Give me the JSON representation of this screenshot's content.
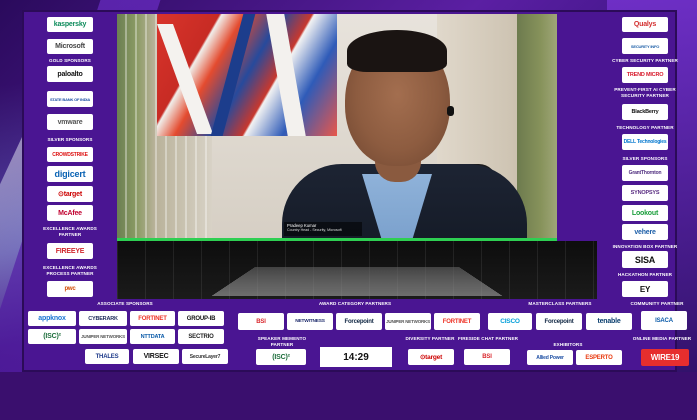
{
  "colors": {
    "accent_purple": "#4a1592",
    "video_green": "#2ecf52"
  },
  "left": {
    "logo_top": "kaspersky",
    "logo_ms": "Microsoft",
    "gold_label": "GOLD SPONSORS",
    "gold": [
      "paloalto",
      "STATE BANK OF INDIA",
      "vmware"
    ],
    "silver_label": "SILVER SPONSORS",
    "silver": [
      "CROWDSTRIKE",
      "digicert",
      "⊙target",
      "McAfee"
    ],
    "excellence_label": "EXCELLENCE AWARDS PARTNER",
    "excellence": "FIREEYE",
    "process_label": "EXCELLENCE AWARDS PROCESS PARTNER",
    "process": "pwc"
  },
  "right": {
    "top": [
      "Qualys",
      "SECURITY INFO"
    ],
    "cyber_label": "CYBER SECURITY PARTNER",
    "cyber": "TREND MICRO",
    "prevent_label": "PREVENT-FIRST AI CYBER SECURITY PARTNER",
    "prevent": "BlackBerry",
    "tech_label": "TECHNOLOGY PARTNER",
    "tech": "DELL Technologies",
    "silver_label": "SILVER SPONSORS",
    "silver": [
      "GrantThornton",
      "SYNOPSYS",
      "Lookout",
      "vehere"
    ],
    "innovation_label": "INNOVATION BOX PARTNER",
    "innovation": "SISA",
    "hackathon_label": "HACKATHON PARTNER",
    "hackathon": "EY"
  },
  "video": {
    "name": "Pradeep Kumar",
    "title": "Country Head - Security, Microsoft"
  },
  "bottom": {
    "associate_label": "ASSOCIATE SPONSORS",
    "associate": [
      "appknox",
      "CYBERARK",
      "FORTINET",
      "GROUP-IB",
      "(ISC)²",
      "JUNIPER NETWORKS",
      "NTTDATA",
      "SECTRIO",
      "THALES",
      "VIRSEC",
      "SecureLayer7"
    ],
    "award_label": "AWARD CATEGORY PARTNERS",
    "award": [
      "BSI",
      "NETWITNESS",
      "Forcepoint",
      "JUNIPER NETWORKS",
      "FORTINET"
    ],
    "memento_label": "SPEAKER MEMENTO PARTNER",
    "memento": "(ISC)²",
    "clock": "14:29",
    "diversity_label": "DIVERSITY PARTNER",
    "diversity": "⊙target",
    "fireside_label": "FIRESIDE CHAT PARTNER",
    "fireside": "BSI",
    "masterclass_label": "MASTERCLASS PARTNERS",
    "masterclass": [
      "CISCO",
      "Forcepoint",
      "tenable"
    ],
    "exhibitors_label": "EXHIBITORS",
    "exhibitors": [
      "Allied Power",
      "ESPERTO"
    ],
    "community_label": "COMMUNITY PARTNER",
    "community": "ISACA",
    "media_label": "ONLINE MEDIA PARTNER",
    "media": "WIRE19"
  }
}
